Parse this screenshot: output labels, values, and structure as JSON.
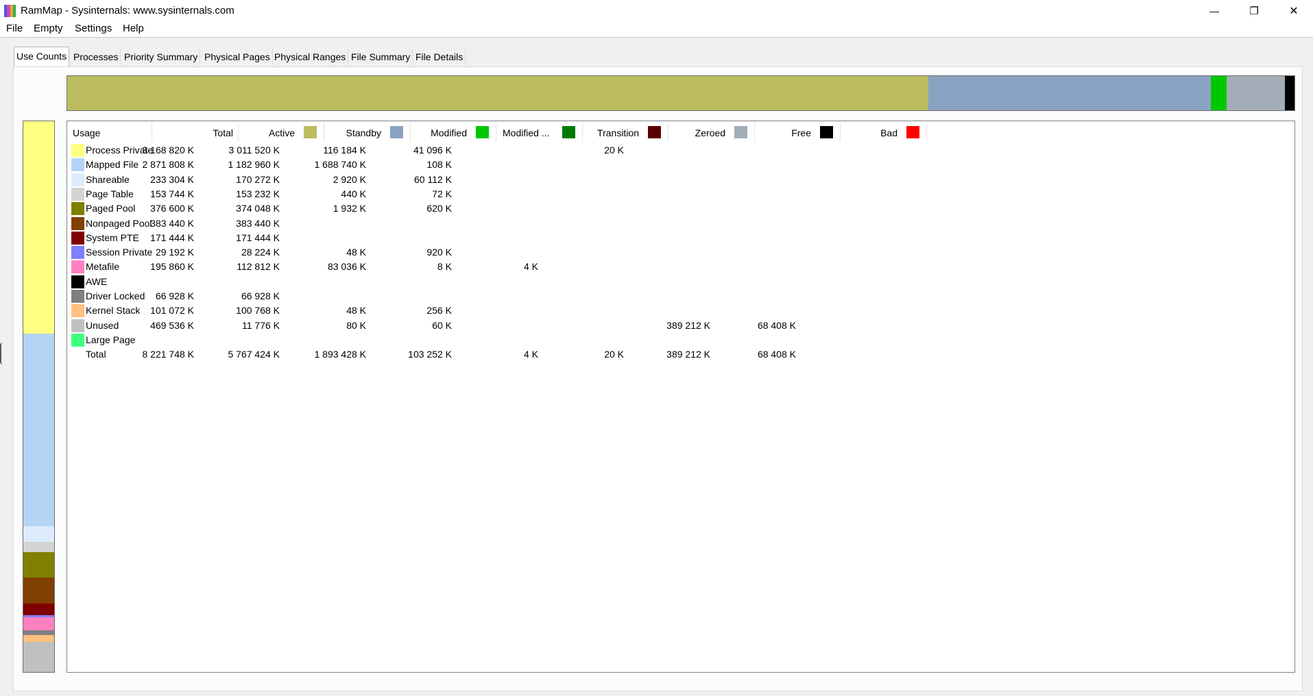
{
  "window": {
    "title": "RamMap - Sysinternals: www.sysinternals.com",
    "app_icon_colors": [
      "#4060e0",
      "#e040c0",
      "#e0b020",
      "#30b050"
    ],
    "controls": {
      "minimize": "—",
      "maximize": "❐",
      "close": "✕"
    }
  },
  "menu": [
    "File",
    "Empty",
    "Settings",
    "Help"
  ],
  "tabs": [
    {
      "label": "Use Counts",
      "active": true
    },
    {
      "label": "Processes"
    },
    {
      "label": "Priority Summary"
    },
    {
      "label": "Physical Pages"
    },
    {
      "label": "Physical Ranges"
    },
    {
      "label": "File Summary"
    },
    {
      "label": "File Details"
    }
  ],
  "columns": [
    {
      "label": "Usage"
    },
    {
      "label": "Total"
    },
    {
      "label": "Active",
      "color": "#bcbc5e"
    },
    {
      "label": "Standby",
      "color": "#8aa3c2"
    },
    {
      "label": "Modified",
      "color": "#00c800"
    },
    {
      "label": "Modified ...",
      "color": "#007a00"
    },
    {
      "label": "Transition",
      "color": "#5a0000"
    },
    {
      "label": "Zeroed",
      "color": "#a3adb8"
    },
    {
      "label": "Free",
      "color": "#000000"
    },
    {
      "label": "Bad",
      "color": "#ff0000"
    }
  ],
  "rows": [
    {
      "name": "Process Private",
      "color": "#ffff80",
      "values": [
        "3 168 820 K",
        "3 011 520 K",
        "116 184 K",
        "41 096 K",
        "",
        "20 K",
        "",
        "",
        ""
      ]
    },
    {
      "name": "Mapped File",
      "color": "#b4d4f6",
      "values": [
        "2 871 808 K",
        "1 182 960 K",
        "1 688 740 K",
        "108 K",
        "",
        "",
        "",
        "",
        ""
      ]
    },
    {
      "name": "Shareable",
      "color": "#dcecfc",
      "values": [
        "233 304 K",
        "170 272 K",
        "2 920 K",
        "60 112 K",
        "",
        "",
        "",
        "",
        ""
      ]
    },
    {
      "name": "Page Table",
      "color": "#d3d3d3",
      "values": [
        "153 744 K",
        "153 232 K",
        "440 K",
        "72 K",
        "",
        "",
        "",
        "",
        ""
      ]
    },
    {
      "name": "Paged Pool",
      "color": "#808000",
      "values": [
        "376 600 K",
        "374 048 K",
        "1 932 K",
        "620 K",
        "",
        "",
        "",
        "",
        ""
      ]
    },
    {
      "name": "Nonpaged Pool",
      "color": "#804000",
      "values": [
        "383 440 K",
        "383 440 K",
        "",
        "",
        "",
        "",
        "",
        "",
        ""
      ]
    },
    {
      "name": "System PTE",
      "color": "#800000",
      "values": [
        "171 444 K",
        "171 444 K",
        "",
        "",
        "",
        "",
        "",
        "",
        ""
      ]
    },
    {
      "name": "Session Private",
      "color": "#8080ff",
      "values": [
        "29 192 K",
        "28 224 K",
        "48 K",
        "920 K",
        "",
        "",
        "",
        "",
        ""
      ]
    },
    {
      "name": "Metafile",
      "color": "#ff80c0",
      "values": [
        "195 860 K",
        "112 812 K",
        "83 036 K",
        "8 K",
        "4 K",
        "",
        "",
        "",
        ""
      ]
    },
    {
      "name": "AWE",
      "color": "#000000",
      "values": [
        "",
        "",
        "",
        "",
        "",
        "",
        "",
        "",
        ""
      ]
    },
    {
      "name": "Driver Locked",
      "color": "#808080",
      "values": [
        "66 928 K",
        "66 928 K",
        "",
        "",
        "",
        "",
        "",
        "",
        ""
      ]
    },
    {
      "name": "Kernel Stack",
      "color": "#ffc080",
      "values": [
        "101 072 K",
        "100 768 K",
        "48 K",
        "256 K",
        "",
        "",
        "",
        "",
        ""
      ]
    },
    {
      "name": "Unused",
      "color": "#c0c0c0",
      "values": [
        "469 536 K",
        "11 776 K",
        "80 K",
        "60 K",
        "",
        "",
        "389 212 K",
        "68 408 K",
        ""
      ]
    },
    {
      "name": "Large Page",
      "color": "#40ff80",
      "values": [
        "",
        "",
        "",
        "",
        "",
        "",
        "",
        "",
        ""
      ]
    },
    {
      "name": "Total",
      "color": "",
      "values": [
        "8 221 748 K",
        "5 767 424 K",
        "1 893 428 K",
        "103 252 K",
        "4 K",
        "20 K",
        "389 212 K",
        "68 408 K",
        ""
      ]
    }
  ],
  "top_bar_colors": [
    "#bcbc5e",
    "#8aa3c2",
    "#00c800",
    "#a3adb8",
    "#000000"
  ],
  "side_bar_colors": [
    "#ffff80",
    "#b4d4f6",
    "#dcecfc",
    "#d3d3d3",
    "#808000",
    "#804000",
    "#800000",
    "#8080ff",
    "#ff80c0",
    "#808080",
    "#ffc080",
    "#c0c0c0"
  ]
}
